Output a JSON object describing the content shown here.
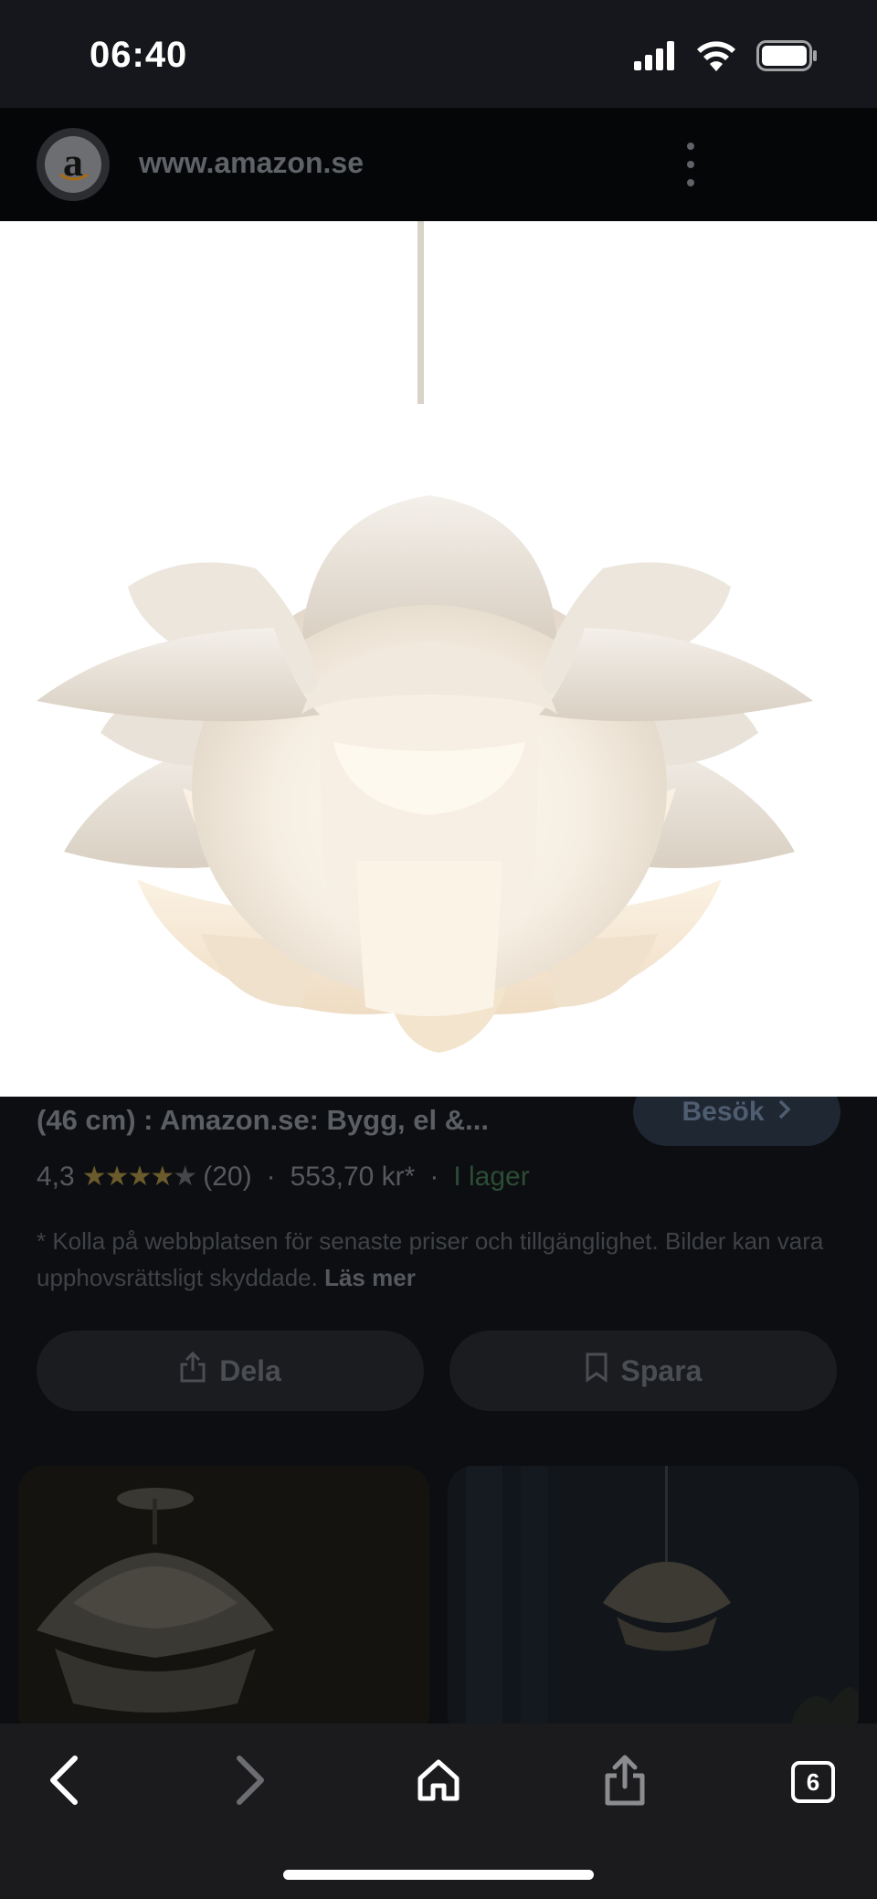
{
  "status_bar": {
    "time": "06:40",
    "icons": [
      "signal-icon",
      "wifi-icon",
      "battery-icon"
    ]
  },
  "url_bar": {
    "site_logo_letter": "a",
    "url": "www.amazon.se",
    "menu_icon": "more-vert-icon"
  },
  "hero_image": {
    "description_icon": "pendant-lamp-image"
  },
  "result": {
    "title": "(46 cm) : Amazon.se: Bygg, el &...",
    "visit_label": "Besök",
    "rating": "4,3",
    "stars_filled": 4.3,
    "stars_total": 5,
    "review_count": "(20)",
    "price": "553,70 kr*",
    "stock": "I lager",
    "disclaimer": "* Kolla på webbplatsen för senaste priser och tillgänglighet. Bilder kan vara upphovsrättsligt skyddade.",
    "read_more": "Läs mer"
  },
  "actions": {
    "share_label": "Dela",
    "save_label": "Spara"
  },
  "toolbar": {
    "back_icon": "chevron-left-icon",
    "forward_icon": "chevron-right-icon",
    "home_icon": "home-icon",
    "share_icon": "share-icon",
    "tab_count": "6"
  },
  "colors": {
    "accent_stars": "#f4c430",
    "stock_green": "#34a853"
  }
}
